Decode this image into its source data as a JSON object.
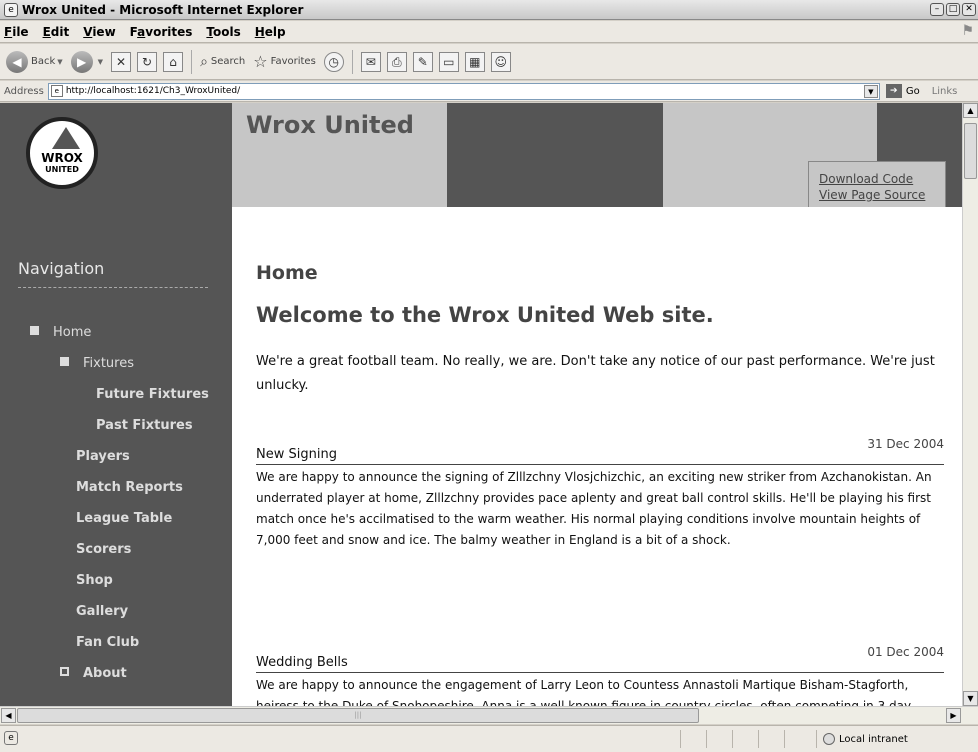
{
  "window": {
    "title": "Wrox United - Microsoft Internet Explorer"
  },
  "menu": [
    {
      "label": "File",
      "key": "F"
    },
    {
      "label": "Edit",
      "key": "E"
    },
    {
      "label": "View",
      "key": "V"
    },
    {
      "label": "Favorites",
      "key": "a"
    },
    {
      "label": "Tools",
      "key": "T"
    },
    {
      "label": "Help",
      "key": "H"
    }
  ],
  "toolbar": {
    "back": "Back",
    "search": "Search",
    "favorites": "Favorites"
  },
  "address": {
    "label": "Address",
    "url": "http://localhost:1621/Ch3_WroxUnited/",
    "go": "Go",
    "links": "Links"
  },
  "status": {
    "zone": "Local intranet"
  },
  "site": {
    "logo_text": "WROX",
    "logo_sub": "UNITED",
    "title": "Wrox United",
    "download_code": "Download Code",
    "view_source": "View Page Source"
  },
  "nav": {
    "heading": "Navigation",
    "items": [
      {
        "label": "Home"
      },
      {
        "label": "Fixtures"
      },
      {
        "label": "Future Fixtures"
      },
      {
        "label": "Past Fixtures"
      },
      {
        "label": "Players"
      },
      {
        "label": "Match Reports"
      },
      {
        "label": "League Table"
      },
      {
        "label": "Scorers"
      },
      {
        "label": "Shop"
      },
      {
        "label": "Gallery"
      },
      {
        "label": "Fan Club"
      },
      {
        "label": "About"
      }
    ]
  },
  "content": {
    "page_heading": "Home",
    "welcome": "Welcome to the Wrox United Web site.",
    "intro": "We're a great football team. No really, we are. Don't take any notice of our past performance. We're just unlucky.",
    "news": [
      {
        "title": "New Signing",
        "date": "31 Dec 2004",
        "body": "We are happy to announce the signing of Zlllzchny Vlosjchizchic, an exciting new striker from Azchanokistan. An underrated player at home, Zlllzchny provides pace aplenty and great ball control skills. He'll be playing his first match once he's accilmatised to the warm weather. His normal playing conditions involve mountain heights of 7,000 feet and snow and ice. The balmy weather in England is a bit of a shock."
      },
      {
        "title": "Wedding Bells",
        "date": "01 Dec 2004",
        "body": "We are happy to announce the engagement of Larry Leon to Countess Annastoli Martique Bisham-Stagforth, heiress to the Duke of Snohopeshire. Anna is a well known figure in country circles, often competing in 3 day eventing for her local horse club. She does tend to take four"
      }
    ]
  }
}
